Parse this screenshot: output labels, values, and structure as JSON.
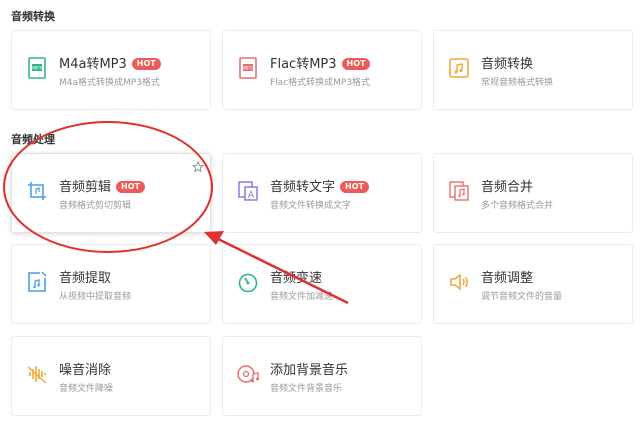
{
  "sections": {
    "conversion_title": "音频转换",
    "processing_title": "音频处理"
  },
  "conversion": [
    {
      "title": "M4a转MP3",
      "hot": "HOT",
      "desc": "M4a格式转换成MP3格式",
      "icon": "m4a-file-icon",
      "color": "#2fb58a"
    },
    {
      "title": "Flac转MP3",
      "hot": "HOT",
      "desc": "Flac格式转换成MP3格式",
      "icon": "flac-file-icon",
      "color": "#e86f6f"
    },
    {
      "title": "音频转换",
      "desc": "常规音频格式转换",
      "icon": "audio-convert-icon",
      "color": "#f2a735"
    }
  ],
  "processing": [
    {
      "title": "音频剪辑",
      "hot": "HOT",
      "desc": "音频格式剪切剪辑",
      "icon": "audio-cut-icon",
      "color": "#4a9ee8"
    },
    {
      "title": "音频转文字",
      "hot": "HOT",
      "desc": "音频文件转换成文字",
      "icon": "audio-to-text-icon",
      "color": "#8a6fe0"
    },
    {
      "title": "音频合并",
      "desc": "多个音频格式合并",
      "icon": "audio-merge-icon",
      "color": "#e86f6f"
    },
    {
      "title": "音频提取",
      "desc": "从视频中提取音频",
      "icon": "audio-extract-icon",
      "color": "#4a9ee8"
    },
    {
      "title": "音频变速",
      "desc": "音频文件加减速",
      "icon": "audio-speed-icon",
      "color": "#2fb58a"
    },
    {
      "title": "音频调整",
      "desc": "调节音频文件的音量",
      "icon": "volume-icon",
      "color": "#f2a735"
    },
    {
      "title": "噪音消除",
      "desc": "音频文件降噪",
      "icon": "noise-reduction-icon",
      "color": "#f2a735"
    },
    {
      "title": "添加背景音乐",
      "desc": "音频文件背景音乐",
      "icon": "background-music-icon",
      "color": "#e86f6f"
    }
  ],
  "annotation_color": "#e03030"
}
